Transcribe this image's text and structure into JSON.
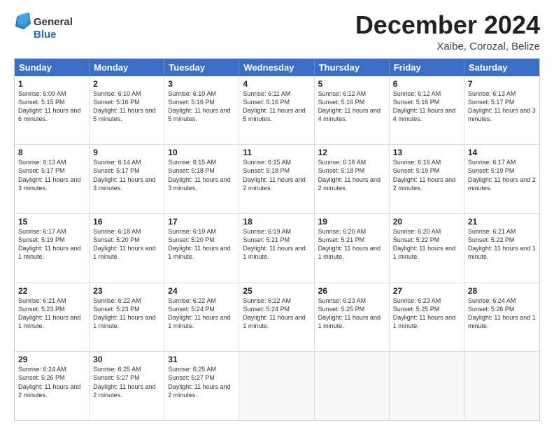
{
  "header": {
    "logo_general": "General",
    "logo_blue": "Blue",
    "month_title": "December 2024",
    "location": "Xaibe, Corozal, Belize"
  },
  "calendar": {
    "days_of_week": [
      "Sunday",
      "Monday",
      "Tuesday",
      "Wednesday",
      "Thursday",
      "Friday",
      "Saturday"
    ],
    "weeks": [
      [
        {
          "day": "1",
          "sunrise": "6:09 AM",
          "sunset": "5:15 PM",
          "daylight": "11 hours and 6 minutes."
        },
        {
          "day": "2",
          "sunrise": "6:10 AM",
          "sunset": "5:16 PM",
          "daylight": "11 hours and 5 minutes."
        },
        {
          "day": "3",
          "sunrise": "6:10 AM",
          "sunset": "5:16 PM",
          "daylight": "11 hours and 5 minutes."
        },
        {
          "day": "4",
          "sunrise": "6:11 AM",
          "sunset": "5:16 PM",
          "daylight": "11 hours and 5 minutes."
        },
        {
          "day": "5",
          "sunrise": "6:12 AM",
          "sunset": "5:16 PM",
          "daylight": "11 hours and 4 minutes."
        },
        {
          "day": "6",
          "sunrise": "6:12 AM",
          "sunset": "5:16 PM",
          "daylight": "11 hours and 4 minutes."
        },
        {
          "day": "7",
          "sunrise": "6:13 AM",
          "sunset": "5:17 PM",
          "daylight": "11 hours and 3 minutes."
        }
      ],
      [
        {
          "day": "8",
          "sunrise": "6:13 AM",
          "sunset": "5:17 PM",
          "daylight": "11 hours and 3 minutes."
        },
        {
          "day": "9",
          "sunrise": "6:14 AM",
          "sunset": "5:17 PM",
          "daylight": "11 hours and 3 minutes."
        },
        {
          "day": "10",
          "sunrise": "6:15 AM",
          "sunset": "5:18 PM",
          "daylight": "11 hours and 3 minutes."
        },
        {
          "day": "11",
          "sunrise": "6:15 AM",
          "sunset": "5:18 PM",
          "daylight": "11 hours and 2 minutes."
        },
        {
          "day": "12",
          "sunrise": "6:16 AM",
          "sunset": "5:18 PM",
          "daylight": "11 hours and 2 minutes."
        },
        {
          "day": "13",
          "sunrise": "6:16 AM",
          "sunset": "5:19 PM",
          "daylight": "11 hours and 2 minutes."
        },
        {
          "day": "14",
          "sunrise": "6:17 AM",
          "sunset": "5:19 PM",
          "daylight": "11 hours and 2 minutes."
        }
      ],
      [
        {
          "day": "15",
          "sunrise": "6:17 AM",
          "sunset": "5:19 PM",
          "daylight": "11 hours and 1 minute."
        },
        {
          "day": "16",
          "sunrise": "6:18 AM",
          "sunset": "5:20 PM",
          "daylight": "11 hours and 1 minute."
        },
        {
          "day": "17",
          "sunrise": "6:19 AM",
          "sunset": "5:20 PM",
          "daylight": "11 hours and 1 minute."
        },
        {
          "day": "18",
          "sunrise": "6:19 AM",
          "sunset": "5:21 PM",
          "daylight": "11 hours and 1 minute."
        },
        {
          "day": "19",
          "sunrise": "6:20 AM",
          "sunset": "5:21 PM",
          "daylight": "11 hours and 1 minute."
        },
        {
          "day": "20",
          "sunrise": "6:20 AM",
          "sunset": "5:22 PM",
          "daylight": "11 hours and 1 minute."
        },
        {
          "day": "21",
          "sunrise": "6:21 AM",
          "sunset": "5:22 PM",
          "daylight": "11 hours and 1 minute."
        }
      ],
      [
        {
          "day": "22",
          "sunrise": "6:21 AM",
          "sunset": "5:23 PM",
          "daylight": "11 hours and 1 minute."
        },
        {
          "day": "23",
          "sunrise": "6:22 AM",
          "sunset": "5:23 PM",
          "daylight": "11 hours and 1 minute."
        },
        {
          "day": "24",
          "sunrise": "6:22 AM",
          "sunset": "5:24 PM",
          "daylight": "11 hours and 1 minute."
        },
        {
          "day": "25",
          "sunrise": "6:22 AM",
          "sunset": "5:24 PM",
          "daylight": "11 hours and 1 minute."
        },
        {
          "day": "26",
          "sunrise": "6:23 AM",
          "sunset": "5:25 PM",
          "daylight": "11 hours and 1 minute."
        },
        {
          "day": "27",
          "sunrise": "6:23 AM",
          "sunset": "5:25 PM",
          "daylight": "11 hours and 1 minute."
        },
        {
          "day": "28",
          "sunrise": "6:24 AM",
          "sunset": "5:26 PM",
          "daylight": "11 hours and 1 minute."
        }
      ],
      [
        {
          "day": "29",
          "sunrise": "6:24 AM",
          "sunset": "5:26 PM",
          "daylight": "11 hours and 2 minutes."
        },
        {
          "day": "30",
          "sunrise": "6:25 AM",
          "sunset": "5:27 PM",
          "daylight": "11 hours and 2 minutes."
        },
        {
          "day": "31",
          "sunrise": "6:25 AM",
          "sunset": "5:27 PM",
          "daylight": "11 hours and 2 minutes."
        },
        null,
        null,
        null,
        null
      ]
    ]
  }
}
